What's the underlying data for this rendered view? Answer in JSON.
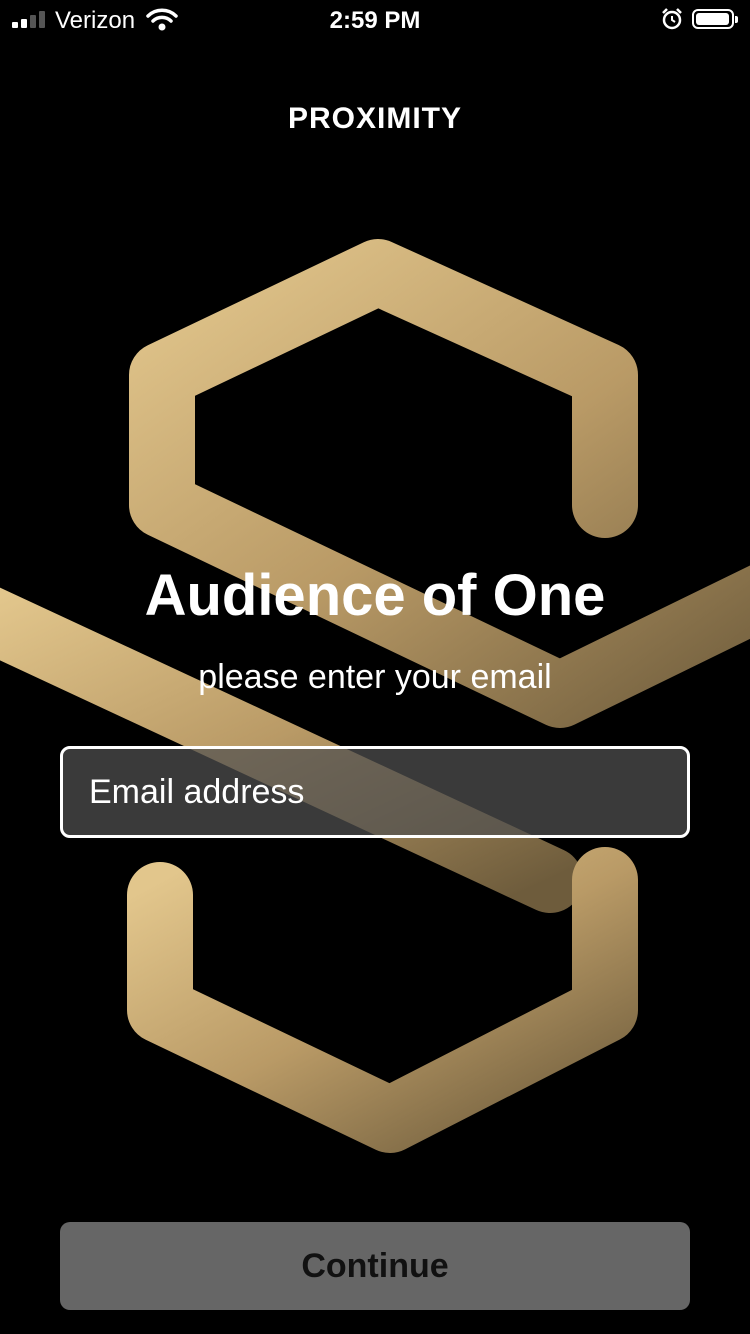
{
  "status_bar": {
    "carrier": "Verizon",
    "time": "2:59 PM",
    "signal_bars": 2,
    "battery_level": 0.9,
    "icons": [
      "signal-icon",
      "wifi-icon",
      "alarm-icon",
      "battery-icon"
    ]
  },
  "header": {
    "title": "PROXIMITY"
  },
  "logo": {
    "icon": "proximity-logo",
    "gradient": [
      "#e2c68c",
      "#b99a66",
      "#7f6a45"
    ]
  },
  "main": {
    "headline": "Audience of One",
    "subline": "please enter your email",
    "email": {
      "placeholder": "Email address",
      "value": ""
    }
  },
  "footer": {
    "continue_label": "Continue",
    "button_color": "#666666"
  }
}
